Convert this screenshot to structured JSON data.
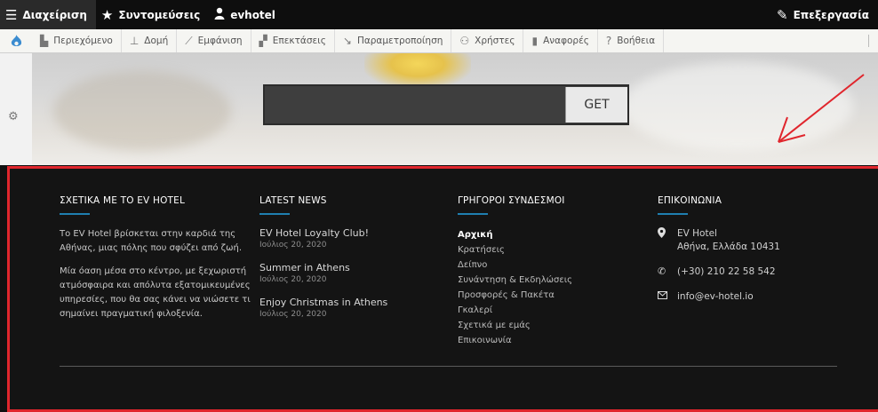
{
  "admin_toolbar": {
    "manage": "Διαχείριση",
    "shortcuts": "Συντομεύσεις",
    "user": "evhotel",
    "edit": "Επεξεργασία"
  },
  "tool_bar": {
    "tabs": [
      {
        "label": "Περιεχόμενο",
        "icon": "document-icon"
      },
      {
        "label": "Δομή",
        "icon": "structure-icon"
      },
      {
        "label": "Εμφάνιση",
        "icon": "brush-icon"
      },
      {
        "label": "Επεκτάσεις",
        "icon": "puzzle-icon"
      },
      {
        "label": "Παραμετροποίηση",
        "icon": "wrench-icon"
      },
      {
        "label": "Χρήστες",
        "icon": "users-icon"
      },
      {
        "label": "Αναφορές",
        "icon": "bar-chart-icon"
      },
      {
        "label": "Βοήθεια",
        "icon": "help-icon"
      }
    ]
  },
  "hero": {
    "search_placeholder": "",
    "button_label": "GET"
  },
  "footer": {
    "about": {
      "title": "ΣΧΕΤΙΚΑ ΜΕ ΤΟ EV HOTEL",
      "p1": "Το EV Hotel βρίσκεται στην καρδιά της Αθήνας, μιας πόλης που σφύζει από ζωή.",
      "p2": "Μία όαση μέσα στο κέντρο, με ξεχωριστή ατμόσφαιρα και απόλυτα εξατομικευμένες υπηρεσίες, που θα σας κάνει να νιώσετε τι σημαίνει πραγματική φιλοξενία."
    },
    "news": {
      "title": "LATEST NEWS",
      "items": [
        {
          "title": "EV Hotel Loyalty Club!",
          "date": "Ιούλιος 20, 2020"
        },
        {
          "title": "Summer in Athens",
          "date": "Ιούλιος 20, 2020"
        },
        {
          "title": "Enjoy Christmas in Athens",
          "date": "Ιούλιος 20, 2020"
        }
      ]
    },
    "links": {
      "title": "ΓΡΗΓΟΡΟΙ ΣΥΝΔΕΣΜΟΙ",
      "items": [
        "Αρχική",
        "Κρατήσεις",
        "Δείπνο",
        "Συνάντηση & Εκδηλώσεις",
        "Προσφορές & Πακέτα",
        "Γκαλερί",
        "Σχετικά με εμάς",
        "Επικοινωνία"
      ]
    },
    "contact": {
      "title": "ΕΠΙΚΟΙΝΩΝΙΑ",
      "name": "EV Hotel",
      "address": "Αθήνα, Ελλάδα 10431",
      "phone": "(+30) 210 22 58 542",
      "email": "info@ev-hotel.io"
    }
  },
  "colors": {
    "accent_underline": "#1f7fb0",
    "highlight_border": "#e0262d",
    "arrow": "#e0262d"
  }
}
